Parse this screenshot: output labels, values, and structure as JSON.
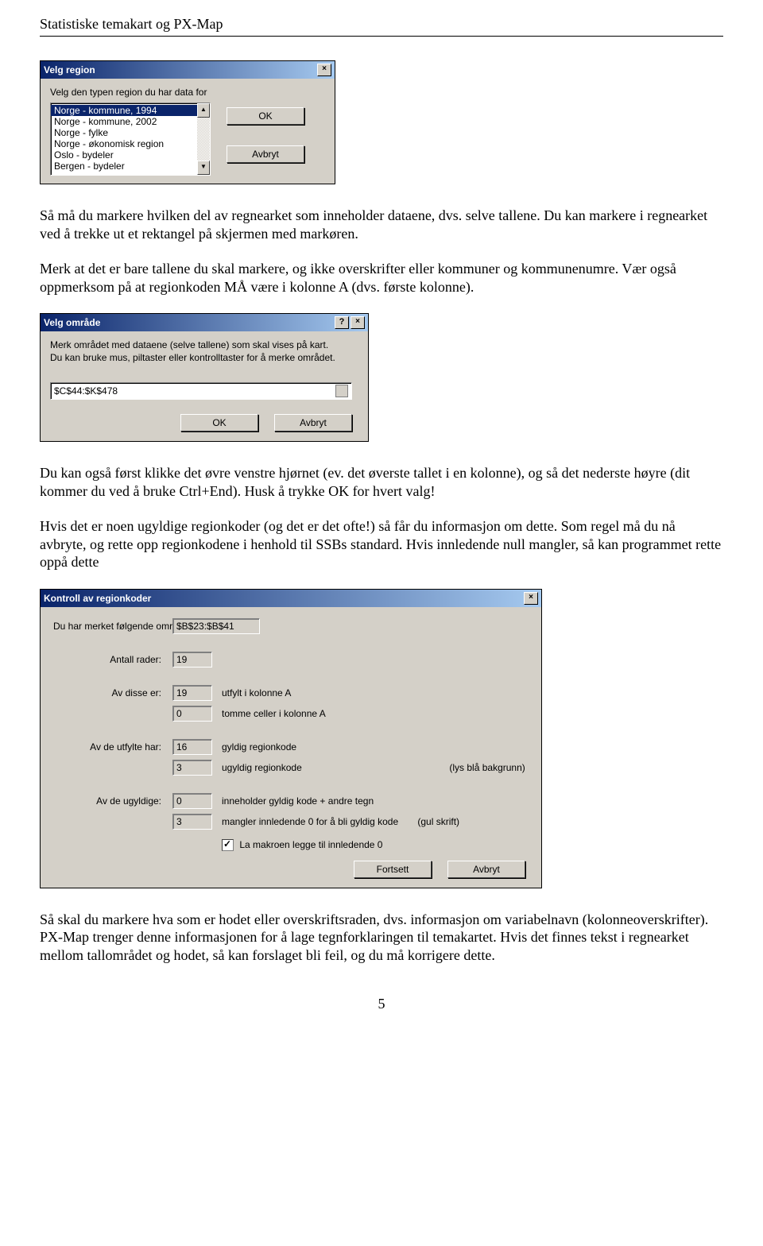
{
  "header": "Statistiske temakart og PX-Map",
  "dialog1": {
    "title": "Velg region",
    "prompt": "Velg den typen region du har data for",
    "items": [
      "Norge - kommune, 1994",
      "Norge - kommune, 2002",
      "Norge - fylke",
      "Norge - økonomisk region",
      "Oslo - bydeler",
      "Bergen - bydeler"
    ],
    "ok": "OK",
    "cancel": "Avbryt"
  },
  "para1": "Så må du markere hvilken del av regnearket som inneholder dataene, dvs. selve tallene. Du kan markere i regnearket ved å trekke ut et rektangel på skjermen med markøren.",
  "para2": "Merk at det er bare tallene du skal markere, og ikke overskrifter eller kommuner og kommunenumre. Vær også oppmerksom på at regionkoden MÅ være i kolonne A (dvs. første kolonne).",
  "dialog2": {
    "title": "Velg område",
    "line1": "Merk området med dataene (selve tallene) som skal vises på kart.",
    "line2": "Du kan bruke mus, piltaster eller kontrolltaster for å merke området.",
    "value": "$C$44:$K$478",
    "ok": "OK",
    "cancel": "Avbryt"
  },
  "para3": "Du kan også først klikke det øvre venstre hjørnet (ev. det øverste tallet i en kolonne), og så det nederste høyre (dit kommer du ved å bruke Ctrl+End). Husk å trykke OK for hvert valg!",
  "para4": "Hvis det er noen ugyldige regionkoder (og det er det ofte!) så får du informasjon om dette. Som regel må du nå avbryte, og rette opp regionkodene i henhold til SSBs standard. Hvis innledende null mangler, så kan programmet rette oppå dette",
  "dialog3": {
    "title": "Kontroll av regionkoder",
    "l_area": "Du har merket følgende område:",
    "v_area": "$B$23:$B$41",
    "l_rows": "Antall rader:",
    "v_rows": "19",
    "l_ofthese": "Av disse er:",
    "v_filled": "19",
    "t_filled": "utfylt i kolonne A",
    "v_empty": "0",
    "t_empty": "tomme celler i kolonne A",
    "l_offilled": "Av de utfylte har:",
    "v_valid": "16",
    "t_valid": "gyldig regionkode",
    "v_invalid": "3",
    "t_invalid": "ugyldig regionkode",
    "t_invalid2": "(lys blå bakgrunn)",
    "l_ofinvalid": "Av de ugyldige:",
    "v_extra": "0",
    "t_extra": "inneholder gyldig kode + andre tegn",
    "v_missing": "3",
    "t_missing": "mangler innledende 0 for å bli gyldig kode",
    "t_missing2": "(gul skrift)",
    "check": "La makroen legge til innledende 0",
    "continue": "Fortsett",
    "cancel": "Avbryt"
  },
  "para5": "Så skal du markere hva som er hodet eller overskriftsraden, dvs. informasjon om variabelnavn (kolonneoverskrifter). PX-Map trenger denne informasjonen for å lage tegnforklaringen til temakartet. Hvis det finnes tekst i regnearket mellom tallområdet og hodet, så kan forslaget bli feil, og du må korrigere dette.",
  "page": "5"
}
